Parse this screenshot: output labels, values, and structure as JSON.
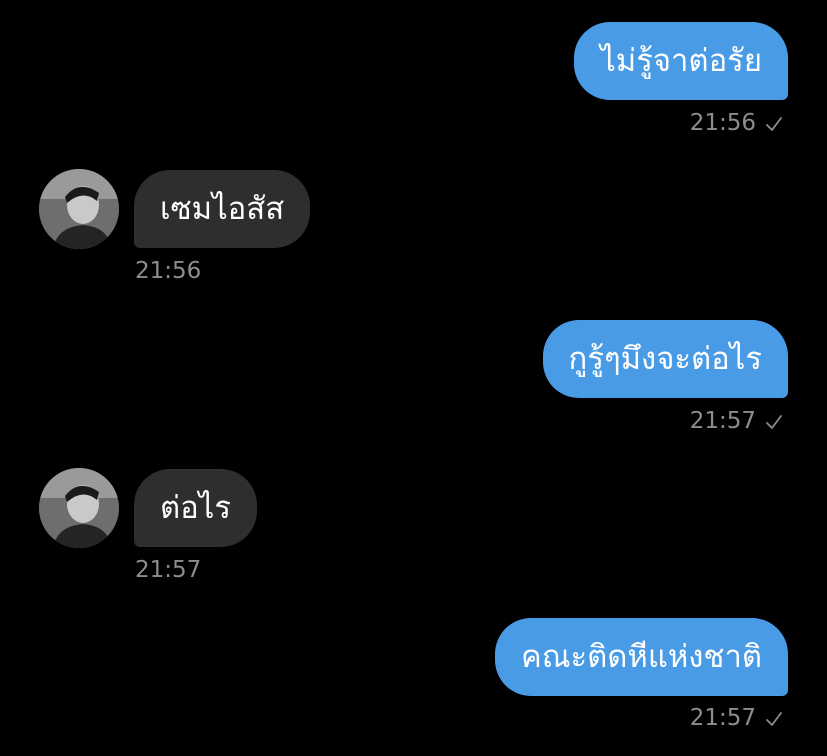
{
  "colors": {
    "background": "#000000",
    "outgoing_bubble": "#4a9be6",
    "incoming_bubble": "#2c2e30",
    "timestamp": "#8b8d91"
  },
  "messages": [
    {
      "direction": "outgoing",
      "text": "ไม่รู้จาต่อรัย",
      "time": "21:56",
      "status_icon": "check-icon"
    },
    {
      "direction": "incoming",
      "text": "เซมไอสัส",
      "time": "21:56",
      "sender_avatar": "avatar"
    },
    {
      "direction": "outgoing",
      "text": "กูรู้ๆมึงจะต่อไร",
      "time": "21:57",
      "status_icon": "check-icon"
    },
    {
      "direction": "incoming",
      "text": "ต่อไร",
      "time": "21:57",
      "sender_avatar": "avatar"
    },
    {
      "direction": "outgoing",
      "text": "คณะติดหีแห่งชาติ",
      "time": "21:57",
      "status_icon": "check-icon"
    }
  ]
}
